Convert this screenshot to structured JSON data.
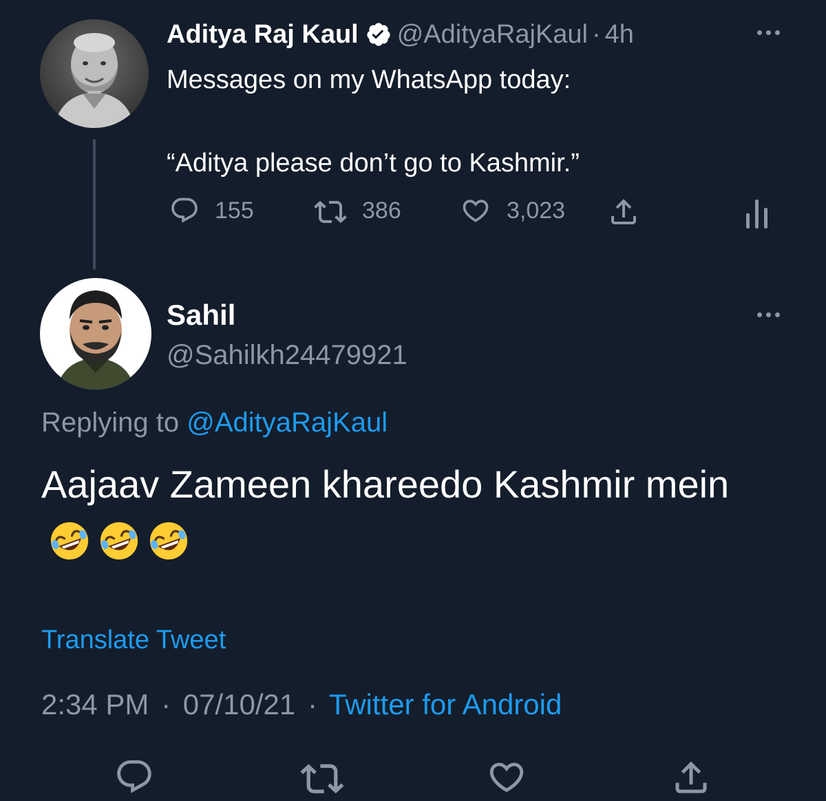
{
  "parent_tweet": {
    "author_name": "Aditya Raj Kaul",
    "handle": "@AdityaRajKaul",
    "separator": "·",
    "time": "4h",
    "text_line1": "Messages on my WhatsApp today:",
    "text_line2": "“Aditya please don’t go to Kashmir.”",
    "replies": "155",
    "retweets": "386",
    "likes": "3,023",
    "verified": true
  },
  "reply_tweet": {
    "author_name": "Sahil",
    "handle": "@Sahilkh24479921",
    "replying_prefix": "Replying to",
    "replying_to": "@AdityaRajKaul",
    "text": "Aajaav Zameen khareedo Kashmir mein",
    "emojis": "🤣🤣🤣",
    "translate_label": "Translate Tweet",
    "time": "2:34 PM",
    "date": "07/10/21",
    "separator": "·",
    "source": "Twitter for Android"
  },
  "icons": {
    "more": "more-horizontal-icon",
    "reply": "speech-bubble-icon",
    "retweet": "retweet-arrows-icon",
    "like": "heart-outline-icon",
    "share": "share-upload-icon",
    "analytics": "bar-chart-icon",
    "verified": "verified-badge-icon"
  },
  "colors": {
    "background": "#141d2b",
    "text": "#ffffff",
    "muted": "#8b98a5",
    "accent": "#1d9bf0",
    "thread_line": "#3d4b5c"
  }
}
